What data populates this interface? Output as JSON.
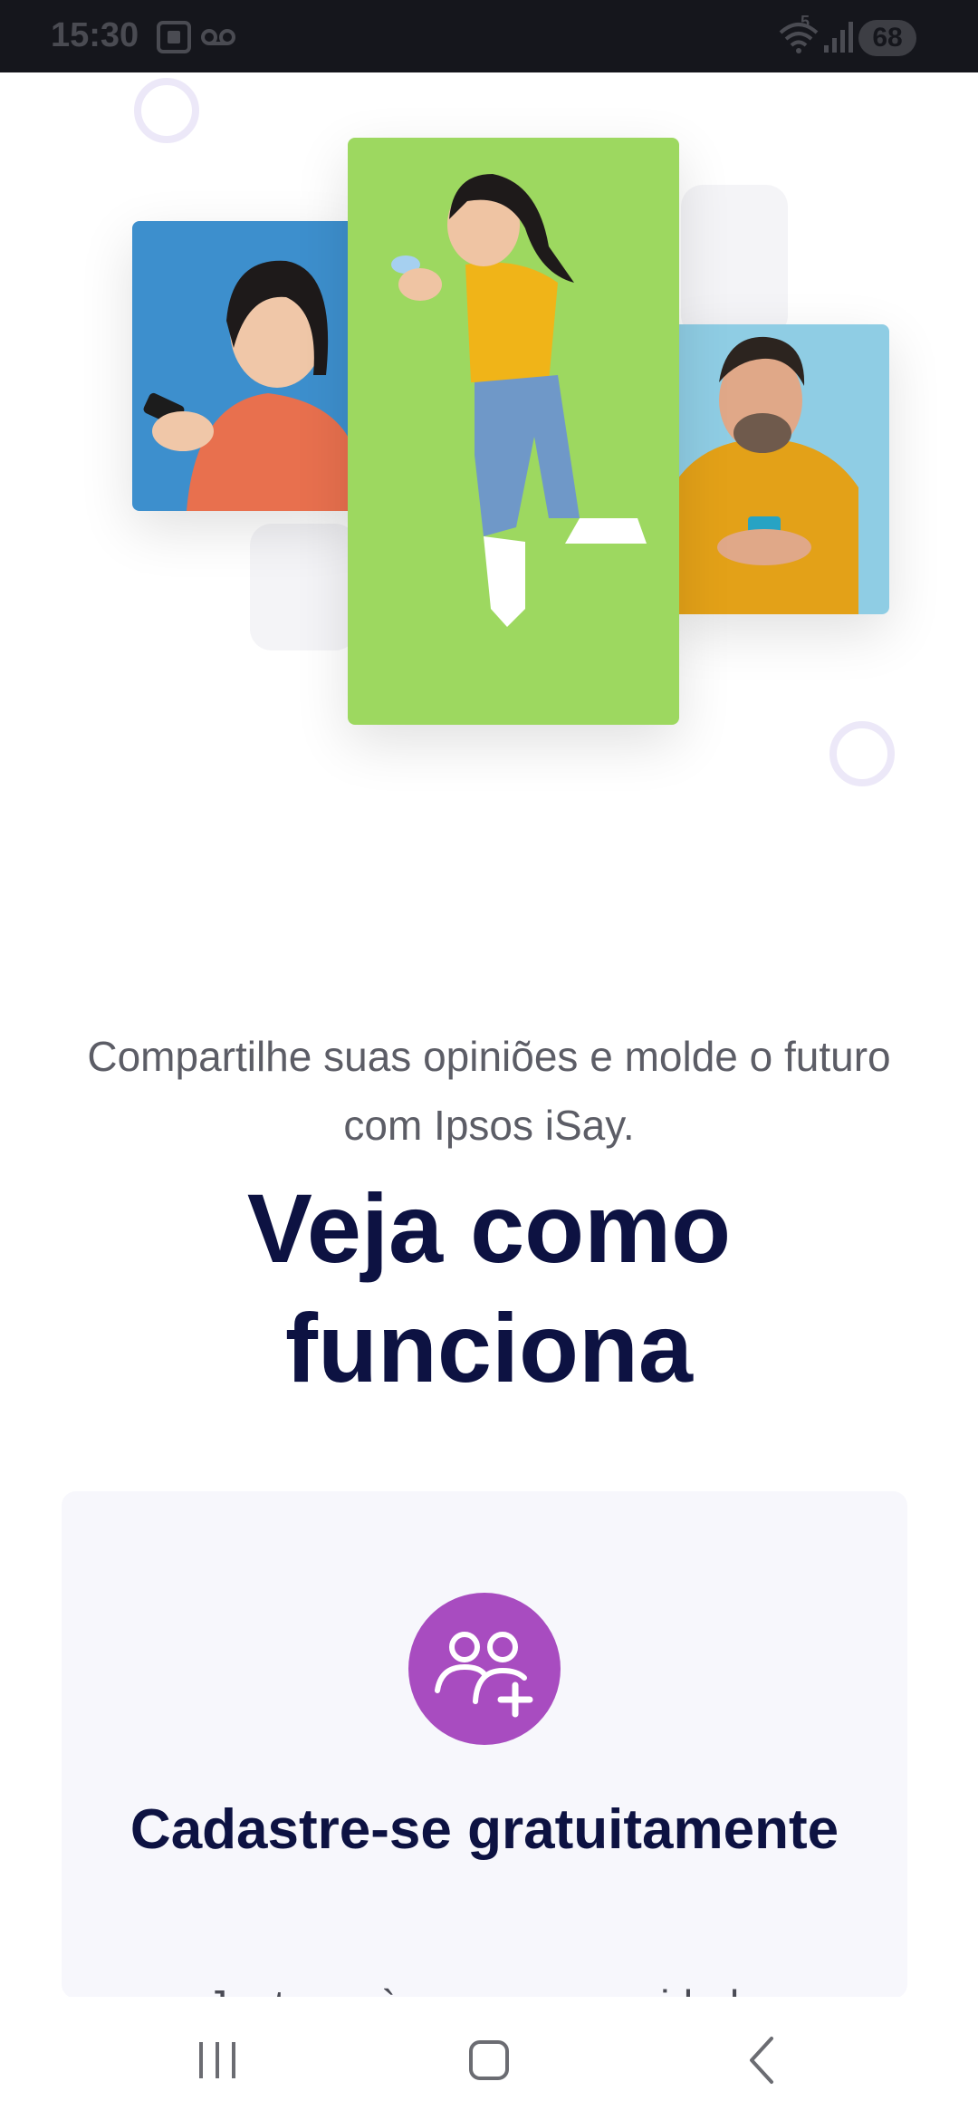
{
  "status_bar": {
    "time": "15:30",
    "network_label": "5",
    "battery": "68",
    "icons": [
      "screenshot-icon",
      "voicemail-icon",
      "wifi-icon",
      "signal-icon",
      "battery-icon"
    ]
  },
  "hero": {
    "images": [
      "woman-with-phone-photo",
      "jumping-woman-photo",
      "man-with-phone-photo"
    ]
  },
  "intro": {
    "tagline": "Compartilhe suas opiniões e molde o futuro com Ipsos iSay.",
    "headline": "Veja como funciona"
  },
  "step": {
    "icon": "users-add-icon",
    "title": "Cadastre-se gratuitamente",
    "description": "Junte-se à nossa comunidade"
  },
  "colors": {
    "headline": "#0d1242",
    "accent": "#a84cc0",
    "card_bg": "#f7f7fc"
  },
  "nav": {
    "buttons": [
      "recents-button",
      "home-button",
      "back-button"
    ]
  }
}
